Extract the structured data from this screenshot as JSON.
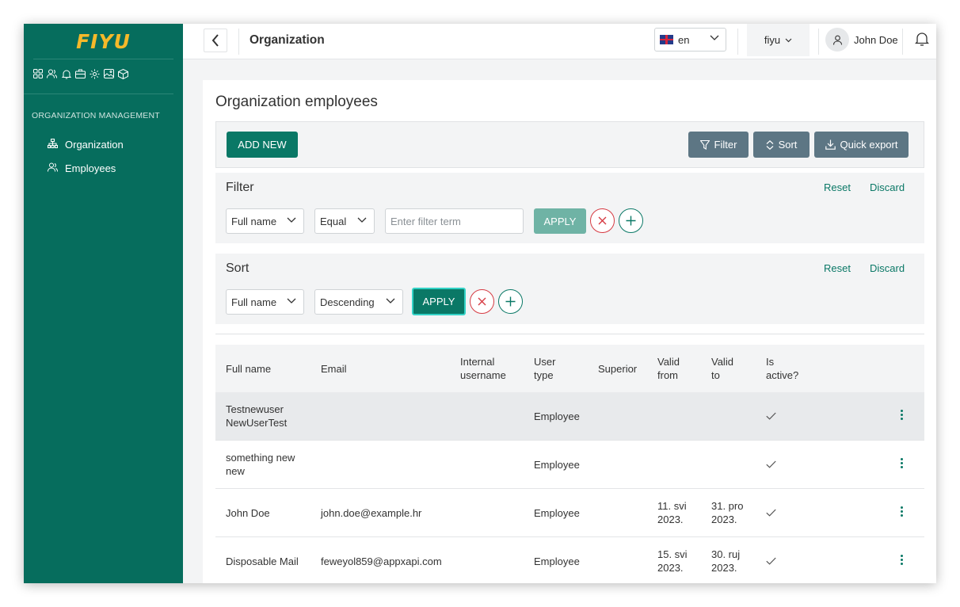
{
  "colors": {
    "sidebar": "#066d5d",
    "accent": "#0a7866",
    "gray_button": "#5d7684",
    "logo": "#f5b92a",
    "danger": "#d63b43"
  },
  "sidebar": {
    "logo": "FIYU",
    "icons": [
      "apps-icon",
      "users-icon",
      "bell-icon",
      "briefcase-icon",
      "settings-icon",
      "image-icon",
      "box-icon"
    ],
    "section_title": "ORGANIZATION MANAGEMENT",
    "items": [
      {
        "label": "Organization",
        "icon": "org-chart-icon"
      },
      {
        "label": "Employees",
        "icon": "users-icon"
      }
    ]
  },
  "topbar": {
    "title": "Organization",
    "language": "en",
    "organization": "fiyu",
    "user": "John Doe"
  },
  "main": {
    "title": "Organization employees",
    "add_new": "ADD NEW",
    "filter_button": "Filter",
    "sort_button": "Sort",
    "export_button": "Quick export"
  },
  "filter": {
    "title": "Filter",
    "reset": "Reset",
    "discard": "Discard",
    "field": "Full name",
    "operator": "Equal",
    "term_placeholder": "Enter filter term",
    "apply": "APPLY"
  },
  "sort": {
    "title": "Sort",
    "reset": "Reset",
    "discard": "Discard",
    "field": "Full name",
    "direction": "Descending",
    "apply": "APPLY"
  },
  "table": {
    "headers": {
      "full_name": "Full name",
      "email": "Email",
      "internal_1": "Internal",
      "internal_2": "username",
      "user_1": "User",
      "user_2": "type",
      "superior": "Superior",
      "from_1": "Valid",
      "from_2": "from",
      "to_1": "Valid",
      "to_2": "to",
      "active_1": "Is",
      "active_2": "active?"
    },
    "rows": [
      {
        "name_1": "Testnewuser",
        "name_2": "NewUserTest",
        "email": "",
        "type": "Employee",
        "from_1": "",
        "from_2": "",
        "to_1": "",
        "to_2": "",
        "active": true
      },
      {
        "name_1": "something new",
        "name_2": "new",
        "email": "",
        "type": "Employee",
        "from_1": "",
        "from_2": "",
        "to_1": "",
        "to_2": "",
        "active": true
      },
      {
        "name_1": "John Doe",
        "name_2": "",
        "email": "john.doe@example.hr",
        "type": "Employee",
        "from_1": "11. svi",
        "from_2": "2023.",
        "to_1": "31. pro",
        "to_2": "2023.",
        "active": true
      },
      {
        "name_1": "Disposable Mail",
        "name_2": "",
        "email": "feweyol859@appxapi.com",
        "type": "Employee",
        "from_1": "15. svi",
        "from_2": "2023.",
        "to_1": "30. ruj",
        "to_2": "2023.",
        "active": true
      }
    ]
  }
}
